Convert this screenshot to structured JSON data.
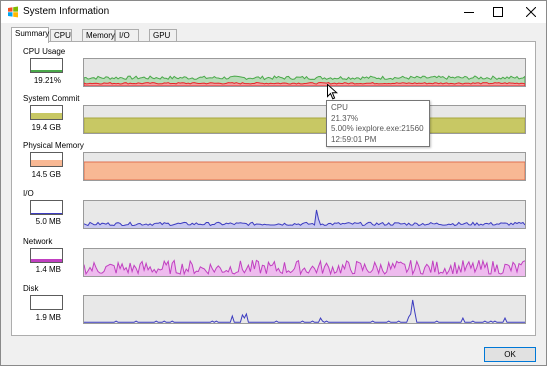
{
  "window": {
    "title": "System Information",
    "icon": "windows-logo-icon",
    "controls": [
      "minimize-icon",
      "maximize-icon",
      "close-icon"
    ]
  },
  "tabs": [
    {
      "label": "Summary",
      "active": true
    },
    {
      "label": "CPU",
      "active": false
    },
    {
      "label": "Memory",
      "active": false
    },
    {
      "label": "I/O",
      "active": false
    },
    {
      "label": "GPU",
      "active": false
    }
  ],
  "sections": [
    {
      "label": "CPU Usage",
      "value": "19.21%",
      "color": "#4aa84a",
      "secondary_color": "#e8262a",
      "fill_level": 0.19
    },
    {
      "label": "System Commit",
      "value": "19.4 GB",
      "color": "#c8c864",
      "fill_level": 0.5
    },
    {
      "label": "Physical Memory",
      "value": "14.5 GB",
      "color": "#f8b894",
      "fill_level": 0.5
    },
    {
      "label": "I/O",
      "value": "5.0  MB",
      "color": "#3c3cc0",
      "fill_level": 0.05
    },
    {
      "label": "Network",
      "value": "1.4  MB",
      "color": "#c040c0",
      "fill_level": 0.2
    },
    {
      "label": "Disk",
      "value": "1.9  MB",
      "color": "#3c3cc0",
      "fill_level": 0.0
    }
  ],
  "tooltip": {
    "line1": "CPU",
    "line2": "21.37%",
    "line3": "5.00% iexplore.exe:21560",
    "line4": "12:59:01 PM"
  },
  "ok_button": {
    "label": "OK"
  }
}
